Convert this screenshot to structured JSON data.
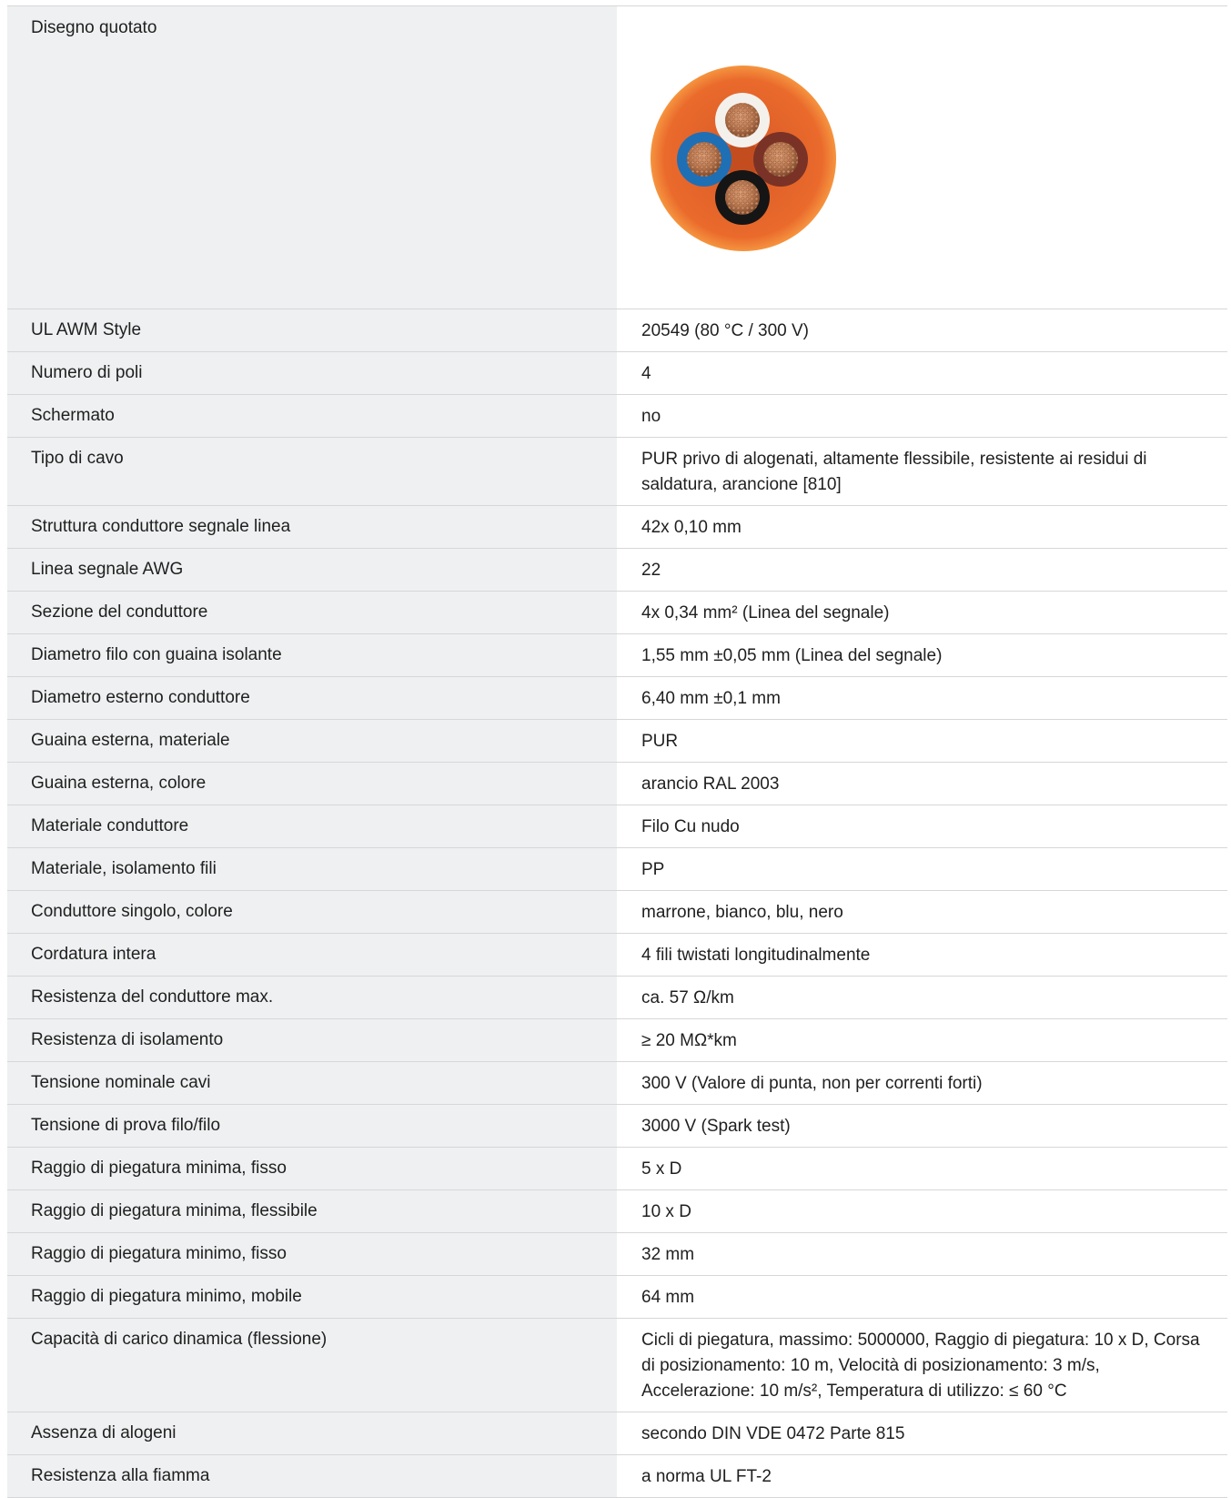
{
  "drawing": {
    "label": "Disegno quotato",
    "image_icon": "cable-cross-section-icon",
    "colors": {
      "jacket": "#ea6a2c",
      "jacket_edge": "#f18a3d",
      "white_core": "#f4f1ec",
      "blue_core": "#1f6fb5",
      "brown_core": "#7a3226",
      "black_core": "#151515",
      "copper": "#b8764f"
    }
  },
  "specs": [
    {
      "label": "UL AWM Style",
      "value": "20549 (80 °C / 300 V)"
    },
    {
      "label": "Numero di poli",
      "value": "4"
    },
    {
      "label": "Schermato",
      "value": "no"
    },
    {
      "label": "Tipo di cavo",
      "value": "PUR privo di alogenati, altamente flessibile, resistente ai residui di saldatura, arancione [810]"
    },
    {
      "label": "Struttura conduttore segnale linea",
      "value": "42x 0,10 mm"
    },
    {
      "label": "Linea segnale AWG",
      "value": "22"
    },
    {
      "label": "Sezione del conduttore",
      "value": "4x 0,34 mm² (Linea del segnale)"
    },
    {
      "label": "Diametro filo con guaina isolante",
      "value": "1,55 mm ±0,05 mm (Linea del segnale)"
    },
    {
      "label": "Diametro esterno conduttore",
      "value": "6,40 mm ±0,1 mm"
    },
    {
      "label": "Guaina esterna, materiale",
      "value": "PUR"
    },
    {
      "label": "Guaina esterna, colore",
      "value": "arancio RAL 2003"
    },
    {
      "label": "Materiale conduttore",
      "value": "Filo Cu nudo"
    },
    {
      "label": "Materiale, isolamento fili",
      "value": "PP"
    },
    {
      "label": "Conduttore singolo, colore",
      "value": "marrone, bianco, blu, nero"
    },
    {
      "label": "Cordatura intera",
      "value": "4 fili twistati longitudinalmente"
    },
    {
      "label": "Resistenza del conduttore max.",
      "value": "ca. 57 Ω/km"
    },
    {
      "label": "Resistenza di isolamento",
      "value": "≥ 20 MΩ*km"
    },
    {
      "label": "Tensione nominale cavi",
      "value": "300 V (Valore di punta, non per correnti forti)"
    },
    {
      "label": "Tensione di prova filo/filo",
      "value": "3000 V (Spark test)"
    },
    {
      "label": "Raggio di piegatura minima, fisso",
      "value": "5 x D"
    },
    {
      "label": "Raggio di piegatura minima, flessibile",
      "value": "10 x D"
    },
    {
      "label": "Raggio di piegatura minimo, fisso",
      "value": "32 mm"
    },
    {
      "label": "Raggio di piegatura minimo, mobile",
      "value": "64 mm"
    },
    {
      "label": "Capacità di carico dinamica (flessione)",
      "value": "Cicli di piegatura, massimo: 5000000, Raggio di piegatura: 10 x D, Corsa di posizionamento: 10 m, Velocità di posizionamento: 3 m/s, Accelerazione: 10 m/s², Temperatura di utilizzo: ≤ 60 °C"
    },
    {
      "label": "Assenza di alogeni",
      "value": "secondo DIN VDE 0472 Parte 815"
    },
    {
      "label": "Resistenza alla fiamma",
      "value": "a norma UL FT-2"
    }
  ]
}
